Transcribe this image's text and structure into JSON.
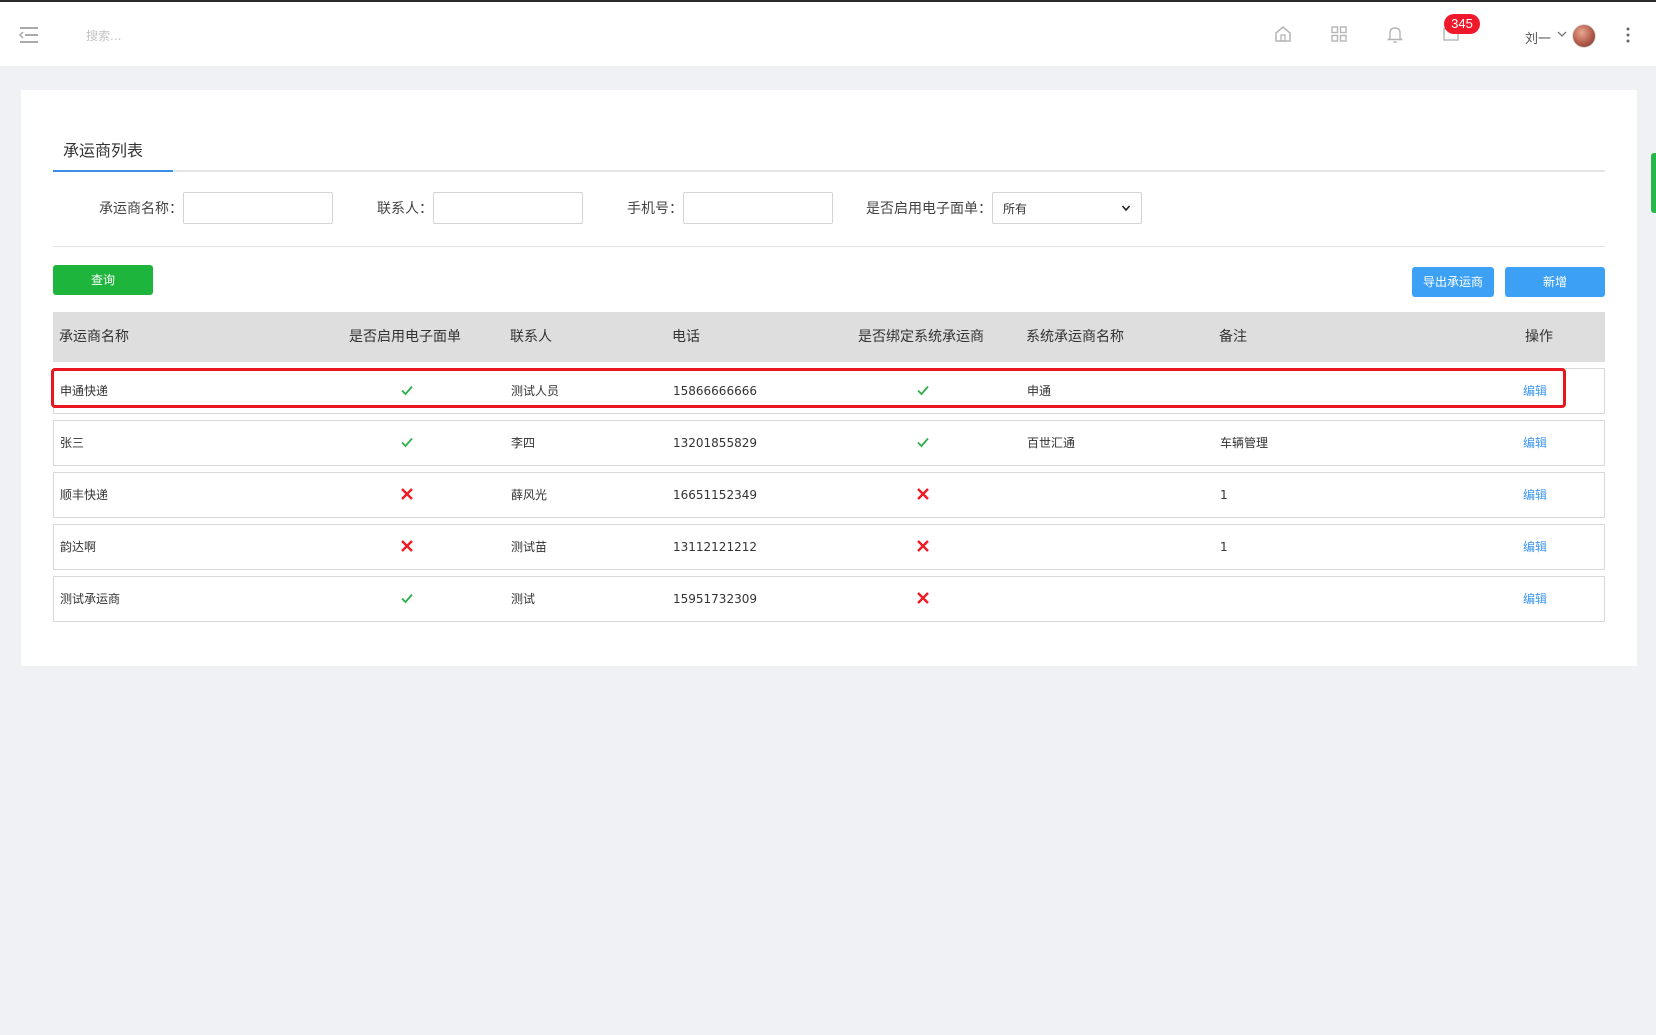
{
  "topbar": {
    "search_placeholder": "搜索...",
    "icons": [
      "menu-toggle-icon",
      "home-icon",
      "apps-grid-icon",
      "bell-icon",
      "message-icon",
      "more-vertical-icon"
    ],
    "badge_count": "345",
    "user_name": "刘一"
  },
  "page": {
    "tab_title": "承运商列表"
  },
  "filters": {
    "name_label": "承运商名称：",
    "contact_label": "联系人：",
    "phone_label": "手机号：",
    "ewaybill_label": "是否启用电子面单：",
    "ewaybill_value": "所有"
  },
  "buttons": {
    "query": "查询",
    "export": "导出承运商",
    "add": "新增"
  },
  "table": {
    "headers": [
      "承运商名称",
      "是否启用电子面单",
      "联系人",
      "电话",
      "是否绑定系统承运商",
      "系统承运商名称",
      "备注",
      "操作"
    ],
    "rows": [
      {
        "name": "申通快递",
        "ewaybill": true,
        "contact": "测试人员",
        "phone": "15866666666",
        "bound": true,
        "sys_name": "申通",
        "remark": "",
        "action": "编辑"
      },
      {
        "name": "张三",
        "ewaybill": true,
        "contact": "李四",
        "phone": "13201855829",
        "bound": true,
        "sys_name": "百世汇通",
        "remark": "车辆管理",
        "action": "编辑"
      },
      {
        "name": "顺丰快递",
        "ewaybill": false,
        "contact": "薛风光",
        "phone": "16651152349",
        "bound": false,
        "sys_name": "",
        "remark": "1",
        "action": "编辑"
      },
      {
        "name": "韵达啊",
        "ewaybill": false,
        "contact": "测试苗",
        "phone": "13112121212",
        "bound": false,
        "sys_name": "",
        "remark": "1",
        "action": "编辑"
      },
      {
        "name": "测试承运商",
        "ewaybill": true,
        "contact": "测试",
        "phone": "15951732309",
        "bound": false,
        "sys_name": "",
        "remark": "",
        "action": "编辑"
      }
    ]
  },
  "colors": {
    "check": "#2eb04a",
    "cross": "#ee1c24",
    "link": "#3c96f0",
    "highlight": "#e8161e"
  }
}
